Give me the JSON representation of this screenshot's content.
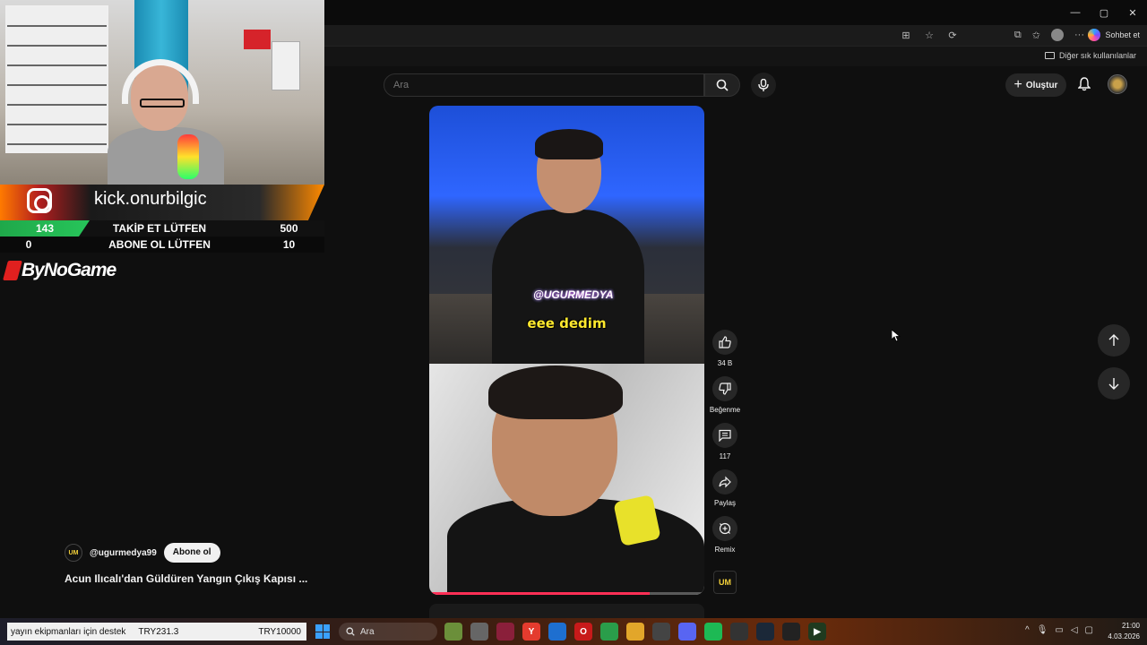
{
  "browser": {
    "window_controls": [
      "—",
      "▢",
      "✕"
    ],
    "copilot_label": "Sohbet et",
    "other_bookmarks": "Diğer sık kullanılanlar"
  },
  "youtube": {
    "search_placeholder": "Ara",
    "create_label": "Oluştur",
    "video": {
      "watermark": "@UGURMEDYA",
      "caption": "eee dedim",
      "progress": 0.8
    },
    "actions": {
      "like_count": "34 B",
      "dislike_label": "Beğenme",
      "comment_count": "117",
      "share_label": "Paylaş",
      "remix_label": "Remix"
    },
    "channel": {
      "handle": "@ugurmedya99",
      "avatar_text": "UM",
      "subscribe_label": "Abone ol"
    },
    "title": "Acun Ilıcalı'dan Güldüren Yangın Çıkış Kapısı ..."
  },
  "stream_overlay": {
    "instagram_handle": "kick.onurbilgic",
    "goal1": {
      "current": "143",
      "label": "TAKİP ET LÜTFEN",
      "target": "500"
    },
    "goal2": {
      "current": "0",
      "label": "ABONE OL LÜTFEN",
      "target": "10"
    },
    "sponsor": "ByNoGame"
  },
  "taskbar": {
    "ticker_text": "yayın ekipmanları için destek",
    "ticker_amount": "TRY231.3",
    "ticker_goal": "TRY10000",
    "search_placeholder": "Ara",
    "time": "21:00",
    "date": "4.03.2026"
  },
  "colors": {
    "background": "#0f0f0f",
    "progress": "#ff2f56",
    "caption": "#ffe92e"
  }
}
